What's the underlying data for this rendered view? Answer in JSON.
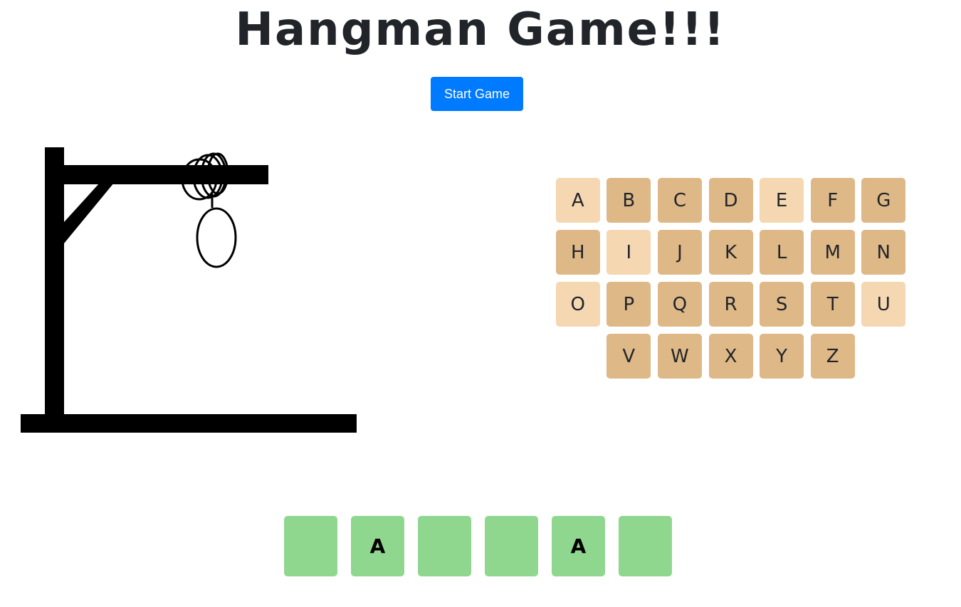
{
  "header": {
    "title": "Hangman Game!!!"
  },
  "controls": {
    "start_label": "Start Game"
  },
  "colors": {
    "start_button": "#007bff",
    "key_unused": "#deb887",
    "key_used": "#f5d7b2",
    "word_slot": "#8fd78f"
  },
  "keyboard": {
    "keys": [
      {
        "letter": "A",
        "used": true
      },
      {
        "letter": "B",
        "used": false
      },
      {
        "letter": "C",
        "used": false
      },
      {
        "letter": "D",
        "used": false
      },
      {
        "letter": "E",
        "used": true
      },
      {
        "letter": "F",
        "used": false
      },
      {
        "letter": "G",
        "used": false
      },
      {
        "letter": "H",
        "used": false
      },
      {
        "letter": "I",
        "used": true
      },
      {
        "letter": "J",
        "used": false
      },
      {
        "letter": "K",
        "used": false
      },
      {
        "letter": "L",
        "used": false
      },
      {
        "letter": "M",
        "used": false
      },
      {
        "letter": "N",
        "used": false
      },
      {
        "letter": "O",
        "used": true
      },
      {
        "letter": "P",
        "used": false
      },
      {
        "letter": "Q",
        "used": false
      },
      {
        "letter": "R",
        "used": false
      },
      {
        "letter": "S",
        "used": false
      },
      {
        "letter": "T",
        "used": false
      },
      {
        "letter": "U",
        "used": true
      },
      {
        "letter": "V",
        "used": false
      },
      {
        "letter": "W",
        "used": false
      },
      {
        "letter": "X",
        "used": false
      },
      {
        "letter": "Y",
        "used": false
      },
      {
        "letter": "Z",
        "used": false
      }
    ]
  },
  "word": {
    "slots": [
      "",
      "A",
      "",
      "",
      "A",
      ""
    ]
  },
  "hangman": {
    "parts_shown": [
      "head"
    ]
  }
}
